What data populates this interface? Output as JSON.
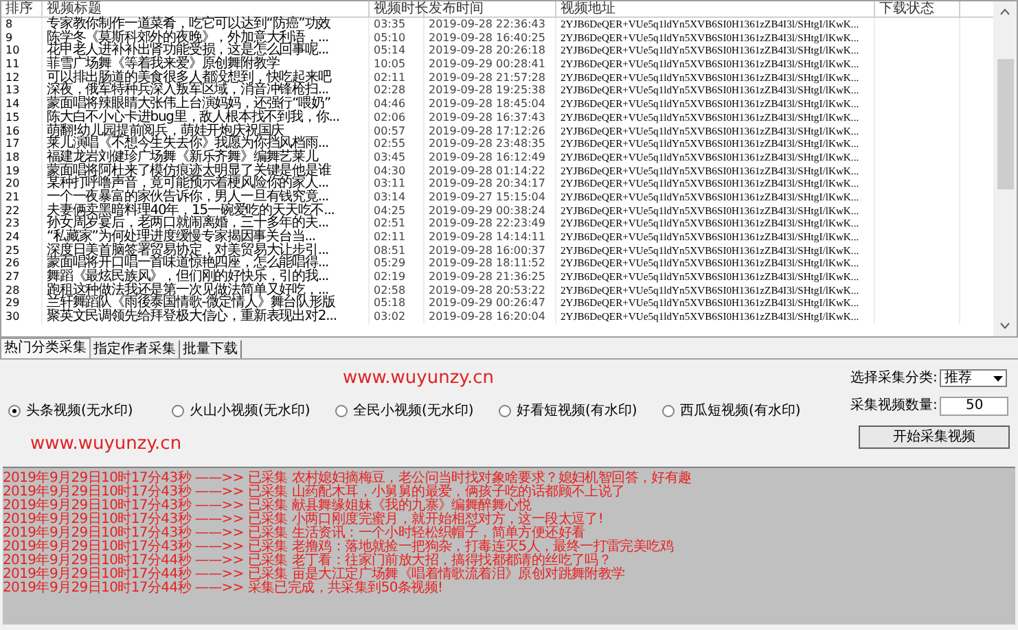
{
  "table": {
    "columns": [
      "排序",
      "视频标题",
      "视频时长",
      "发布时间",
      "视频地址",
      "下载状态"
    ],
    "rows": [
      {
        "index": "8",
        "title": "专家教你制作一道菜肴，吃它可以达到“防癌”功效",
        "duration": "03:35",
        "published": "2019-09-28 22:36:43",
        "url": "2YJB6DeQER+VUe5q1ldYn5XVB6SI0H1361zZB4I3l/SHtgI/lKwK..."
      },
      {
        "index": "9",
        "title": "陈学冬《莫斯科郊外的夜晚》，外加意大利语，...",
        "duration": "05:10",
        "published": "2019-09-28 16:40:25",
        "url": "2YJB6DeQER+VUe5q1ldYn5XVB6SI0H1361zZB4I3l/SHtgI/lKwK..."
      },
      {
        "index": "10",
        "title": "花甲老人进补补出肾功能受损，这是怎么回事呢...",
        "duration": "05:14",
        "published": "2019-09-28 20:26:18",
        "url": "2YJB6DeQER+VUe5q1ldYn5XVB6SI0H1361zZB4I3l/SHtgI/lKwK..."
      },
      {
        "index": "11",
        "title": "菲雪广场舞《等着我来爱》原创舞附教学",
        "duration": "10:05",
        "published": "2019-09-29 00:28:41",
        "url": "2YJB6DeQER+VUe5q1ldYn5XVB6SI0H1361zZB4I3l/SHtgI/lKwK..."
      },
      {
        "index": "12",
        "title": "可以排出肠道的美食很多人都没想到，快吃起来吧",
        "duration": "02:11",
        "published": "2019-09-28 21:57:28",
        "url": "2YJB6DeQER+VUe5q1ldYn5XVB6SI0H1361zZB4I3l/SHtgI/lKwK..."
      },
      {
        "index": "13",
        "title": "深夜，俄军特种兵深入叛军区域，消音冲锋枪扫...",
        "duration": "02:28",
        "published": "2019-09-28 19:25:38",
        "url": "2YJB6DeQER+VUe5q1ldYn5XVB6SI0H1361zZB4I3l/SHtgI/lKwK..."
      },
      {
        "index": "14",
        "title": "蒙面唱将辣眼睛大张伟上台演妈妈，还强行“喂奶”",
        "duration": "04:46",
        "published": "2019-09-28 18:45:04",
        "url": "2YJB6DeQER+VUe5q1ldYn5XVB6SI0H1361zZB4I3l/SHtgI/lKwK..."
      },
      {
        "index": "15",
        "title": "陈大白不小心卡进bug里，敌人根本找不到我，你...",
        "duration": "02:06",
        "published": "2019-09-28 16:37:43",
        "url": "2YJB6DeQER+VUe5q1ldYn5XVB6SI0H1361zZB4I3l/SHtgI/lKwK..."
      },
      {
        "index": "16",
        "title": "萌翻!幼儿园提前阅兵，萌娃开炮庆祝国庆",
        "duration": "00:57",
        "published": "2019-09-28 17:12:26",
        "url": "2YJB6DeQER+VUe5q1ldYn5XVB6SI0H1361zZB4I3l/SHtgI/lKwK..."
      },
      {
        "index": "17",
        "title": "莱儿演唱《不想今生失去你》我愿为你挡风档雨...",
        "duration": "02:55",
        "published": "2019-09-28 23:48:35",
        "url": "2YJB6DeQER+VUe5q1ldYn5XVB6SI0H1361zZB4I3l/SHtgI/lKwK..."
      },
      {
        "index": "18",
        "title": "福建龙岩刘健珍广场舞《新乐齐舞》编舞艺莱儿",
        "duration": "03:45",
        "published": "2019-09-28 16:12:49",
        "url": "2YJB6DeQER+VUe5q1ldYn5XVB6SI0H1361zZB4I3l/SHtgI/lKwK..."
      },
      {
        "index": "19",
        "title": "蒙面唱将阿杜来了模仿痕迹太明显了关键是他是谁",
        "duration": "04:30",
        "published": "2019-09-28 01:14:22",
        "url": "2YJB6DeQER+VUe5q1ldYn5XVB6SI0H1361zZB4I3l/SHtgI/lKwK..."
      },
      {
        "index": "20",
        "title": "某种打呼噜声音，竟可能预示着梗风险你的家人...",
        "duration": "03:11",
        "published": "2019-09-28 20:34:17",
        "url": "2YJB6DeQER+VUe5q1ldYn5XVB6SI0H1361zZB4I3l/SHtgI/lKwK..."
      },
      {
        "index": "21",
        "title": "一个一夜暴富的家伙告诉你，男人一旦有钱究竟...",
        "duration": "03:14",
        "published": "2019-09-27 15:15:04",
        "url": "2YJB6DeQER+VUe5q1ldYn5XVB6SI0H1361zZB4I3l/SHtgI/lKwK..."
      },
      {
        "index": "22",
        "title": "夫妻俩卖黑暗料理40年，15一碗爱吃的天天吃不...",
        "duration": "04:25",
        "published": "2019-09-29 00:38:24",
        "url": "2YJB6DeQER+VUe5q1ldYn5XVB6SI0H1361zZB4I3l/SHtgI/lKwK..."
      },
      {
        "index": "23",
        "title": "孙女周岁宴后，老两口就闹离婚，三十多年的夫...",
        "duration": "02:51",
        "published": "2019-09-28 22:23:49",
        "url": "2YJB6DeQER+VUe5q1ldYn5XVB6SI0H1361zZB4I3l/SHtgI/lKwK..."
      },
      {
        "index": "24",
        "title": "“私藏家”为何处理进度缓慢专家揭因事关台当...",
        "duration": "02:11",
        "published": "2019-09-28 14:14:11",
        "url": "2YJB6DeQER+VUe5q1ldYn5XVB6SI0H1361zZB4I3l/SHtgI/lKwK..."
      },
      {
        "index": "25",
        "title": "深度日美首脑签署贸易协定，对美贸易大让步引...",
        "duration": "08:51",
        "published": "2019-09-28 16:00:37",
        "url": "2YJB6DeQER+VUe5q1ldYn5XVB6SI0H1361zZB4I3l/SHtgI/lKwK..."
      },
      {
        "index": "26",
        "title": "蒙面唱将开口唱一首味道惊艳四座，怎么能唱得...",
        "duration": "05:29",
        "published": "2019-09-28 18:11:52",
        "url": "2YJB6DeQER+VUe5q1ldYn5XVB6SI0H1361zZB4I3l/SHtgI/lKwK..."
      },
      {
        "index": "27",
        "title": "舞蹈《最炫民族风》，但们刚的好快乐，引的我...",
        "duration": "02:19",
        "published": "2019-09-28 21:36:25",
        "url": "2YJB6DeQER+VUe5q1ldYn5XVB6SI0H1361zZB4I3l/SHtgI/lKwK..."
      },
      {
        "index": "28",
        "title": "跑租这种做法我还是第一次见做法简单又好吃，...",
        "duration": "02:58",
        "published": "2019-09-28 20:53:22",
        "url": "2YJB6DeQER+VUe5q1ldYn5XVB6SI0H1361zZB4I3l/SHtgI/lKwK..."
      },
      {
        "index": "29",
        "title": "兰轩舞蹈队《雨後泰国情歌-微定情人》舞台队形版",
        "duration": "05:18",
        "published": "2019-09-29 00:26:47",
        "url": "2YJB6DeQER+VUe5q1ldYn5XVB6SI0H1361zZB4I3l/SHtgI/lKwK..."
      },
      {
        "index": "30",
        "title": "聚英文民调领先给拜登极大信心，重新表现出对2...",
        "duration": "03:02",
        "published": "2019-09-28 16:20:04",
        "url": "2YJB6DeQER+VUe5q1ldYn5XVB6SI0H1361zZB4I3l/SHtgI/lKwK..."
      }
    ]
  },
  "tabs": [
    {
      "label": "热门分类采集",
      "selected": true
    },
    {
      "label": "指定作者采集",
      "selected": false
    },
    {
      "label": "批量下载",
      "selected": false
    }
  ],
  "site_links": [
    "www.wuyunzy.cn",
    "www.wuyunzy.cn"
  ],
  "sources": [
    {
      "label": "头条视频(无水印)",
      "selected": true
    },
    {
      "label": "火山小视频(无水印)",
      "selected": false
    },
    {
      "label": "全民小视频(无水印)",
      "selected": false
    },
    {
      "label": "好看短视频(有水印)",
      "selected": false
    },
    {
      "label": "西瓜短视频(有水印)",
      "selected": false
    }
  ],
  "category": {
    "label": "选择采集分类:",
    "value": "推荐"
  },
  "count": {
    "label": "采集视频数量:",
    "value": "50"
  },
  "start_button": "开始采集视频",
  "log": [
    "2019年9月29日10时17分43秒 ——>> 已采集 农村媳妇摘梅豆，老公问当时找对象啥要求？媳妇机智回答，好有趣",
    "2019年9月29日10时17分43秒 ——>> 已采集 山药配木耳，小舅舅的最爱，俩孩子吃的话都顾不上说了",
    "2019年9月29日10时17分43秒 ——>> 已采集 献县舞缘姐妹《我的九寨》编舞醉舞心悦",
    "2019年9月29日10时17分43秒 ——>> 已采集 小两口刚度完蜜月，就开始相怼对方，这一段太逗了!",
    "2019年9月29日10时17分43秒 ——>> 已采集 生活资讯：一个小时轻松织帽子，简单方便还好看",
    "2019年9月29日10时17分43秒 ——>> 已采集 老撸鸡：落地就捡一把狗杂，打毒连灭5人，最终一打雷完美吃鸡",
    "2019年9月29日10时17分44秒 ——>> 已采集 老丁看：往家门前放大招，搞得找都都请的丝吃了吗？",
    "2019年9月29日10时17分44秒 ——>> 已采集 亩是大江定广场舞《唱着情歌流着泪》原创对跳舞附教学",
    "2019年9月29日10时17分44秒 ——>> 采集已完成，共采集到50条视频!"
  ]
}
